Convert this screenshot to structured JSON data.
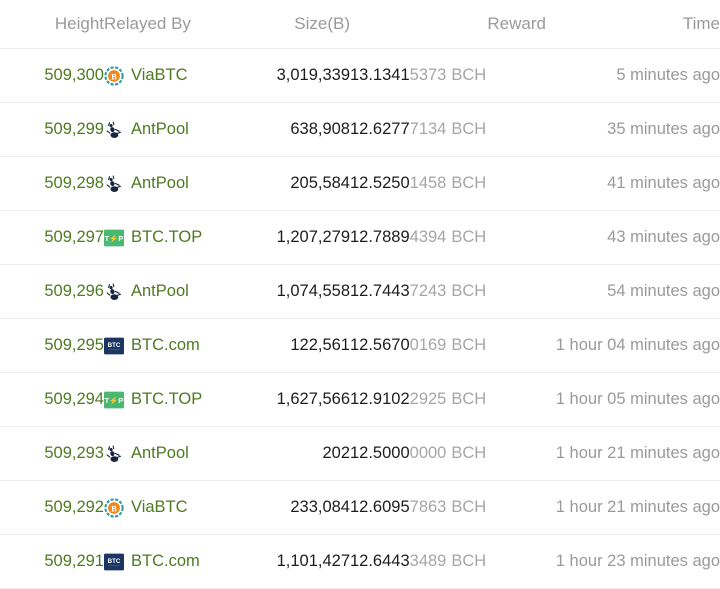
{
  "table": {
    "columns": [
      {
        "key": "height",
        "label": "Height"
      },
      {
        "key": "relayed",
        "label": "Relayed By"
      },
      {
        "key": "size",
        "label": "Size(B)"
      },
      {
        "key": "reward",
        "label": "Reward"
      },
      {
        "key": "time",
        "label": "Time"
      }
    ],
    "colors": {
      "height_green": "#4e7a20",
      "pool_green": "#4e7a20",
      "header_gray": "#9a9a9a",
      "value_dark": "#1d1d1d",
      "muted_gray": "#a6a6a6",
      "row_divider": "#ececec"
    },
    "reward_unit": "BCH",
    "rows": [
      {
        "height": "509,300",
        "pool": "ViaBTC",
        "pool_icon": "viabtc-icon",
        "size": "3,019,339",
        "reward_main": "13.1341",
        "reward_tail": "5373",
        "reward_unit": "BCH",
        "time": "5 minutes ago"
      },
      {
        "height": "509,299",
        "pool": "AntPool",
        "pool_icon": "antpool-icon",
        "size": "638,908",
        "reward_main": "12.6277",
        "reward_tail": "7134",
        "reward_unit": "BCH",
        "time": "35 minutes ago"
      },
      {
        "height": "509,298",
        "pool": "AntPool",
        "pool_icon": "antpool-icon",
        "size": "205,584",
        "reward_main": "12.5250",
        "reward_tail": "1458",
        "reward_unit": "BCH",
        "time": "41 minutes ago"
      },
      {
        "height": "509,297",
        "pool": "BTC.TOP",
        "pool_icon": "btctop-icon",
        "size": "1,207,279",
        "reward_main": "12.7889",
        "reward_tail": "4394",
        "reward_unit": "BCH",
        "time": "43 minutes ago"
      },
      {
        "height": "509,296",
        "pool": "AntPool",
        "pool_icon": "antpool-icon",
        "size": "1,074,558",
        "reward_main": "12.7443",
        "reward_tail": "7243",
        "reward_unit": "BCH",
        "time": "54 minutes ago"
      },
      {
        "height": "509,295",
        "pool": "BTC.com",
        "pool_icon": "btccom-icon",
        "size": "122,561",
        "reward_main": "12.5670",
        "reward_tail": "0169",
        "reward_unit": "BCH",
        "time": "1 hour 04 minutes ago"
      },
      {
        "height": "509,294",
        "pool": "BTC.TOP",
        "pool_icon": "btctop-icon",
        "size": "1,627,566",
        "reward_main": "12.9102",
        "reward_tail": "2925",
        "reward_unit": "BCH",
        "time": "1 hour 05 minutes ago"
      },
      {
        "height": "509,293",
        "pool": "AntPool",
        "pool_icon": "antpool-icon",
        "size": "202",
        "reward_main": "12.5000",
        "reward_tail": "0000",
        "reward_unit": "BCH",
        "time": "1 hour 21 minutes ago"
      },
      {
        "height": "509,292",
        "pool": "ViaBTC",
        "pool_icon": "viabtc-icon",
        "size": "233,084",
        "reward_main": "12.6095",
        "reward_tail": "7863",
        "reward_unit": "BCH",
        "time": "1 hour 21 minutes ago"
      },
      {
        "height": "509,291",
        "pool": "BTC.com",
        "pool_icon": "btccom-icon",
        "size": "1,101,427",
        "reward_main": "12.6443",
        "reward_tail": "3489",
        "reward_unit": "BCH",
        "time": "1 hour 23 minutes ago"
      }
    ]
  }
}
